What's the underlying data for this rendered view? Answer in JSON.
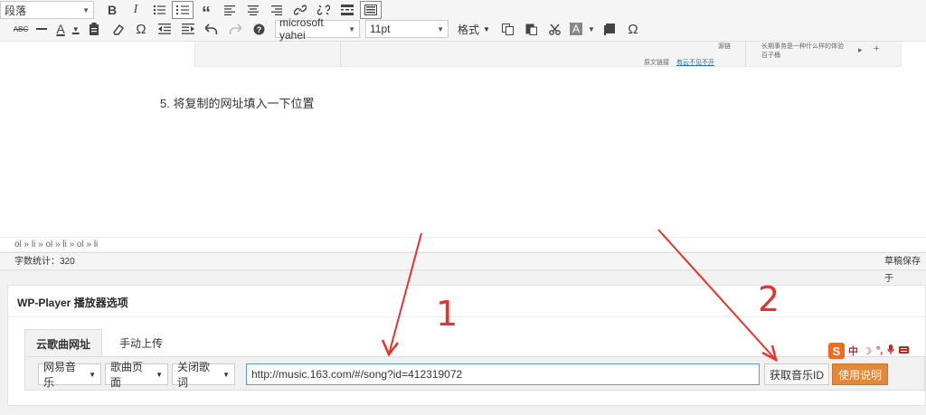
{
  "toolbar": {
    "row1": {
      "paragraph_select": "段落",
      "bold": "B",
      "italic": "I",
      "quote": "“"
    },
    "row2": {
      "strike": "ABC",
      "font_family": "microsoft yahei",
      "font_size": "11pt",
      "format_label": "格式",
      "text_color_letter": "A",
      "bg_color_letter": "A",
      "omega": "Ω",
      "omega2": "Ω"
    }
  },
  "editor": {
    "body_text": "5. 将复制的网址填入一下位置",
    "preview_text_1": "长期事务是一种什么样的体验",
    "preview_text_2": "百子桶",
    "preview_link_label": "原文链接",
    "preview_link": "有云不见不开",
    "preview_source": "源链"
  },
  "pathbar": {
    "path": "ol » li » ol » li » ol » li"
  },
  "statusbar": {
    "wordcount": "字数统计：320",
    "draft": "草稿保存于"
  },
  "metabox": {
    "title": "WP-Player 播放器选项",
    "tabs": [
      {
        "label": "云歌曲网址"
      },
      {
        "label": "手动上传"
      }
    ],
    "source_select": "网易音乐",
    "page_select": "歌曲页面",
    "lyrics_select": "关闭歌词",
    "url_value": "http://music.163.com/#/song?id=412319072",
    "get_id_button": "获取音乐ID",
    "help_button": "使用说明"
  },
  "ime": {
    "logo": "S",
    "lang": "中"
  },
  "annotations": {
    "label_1": "1",
    "label_2": "2",
    "color": "#e8322d"
  }
}
